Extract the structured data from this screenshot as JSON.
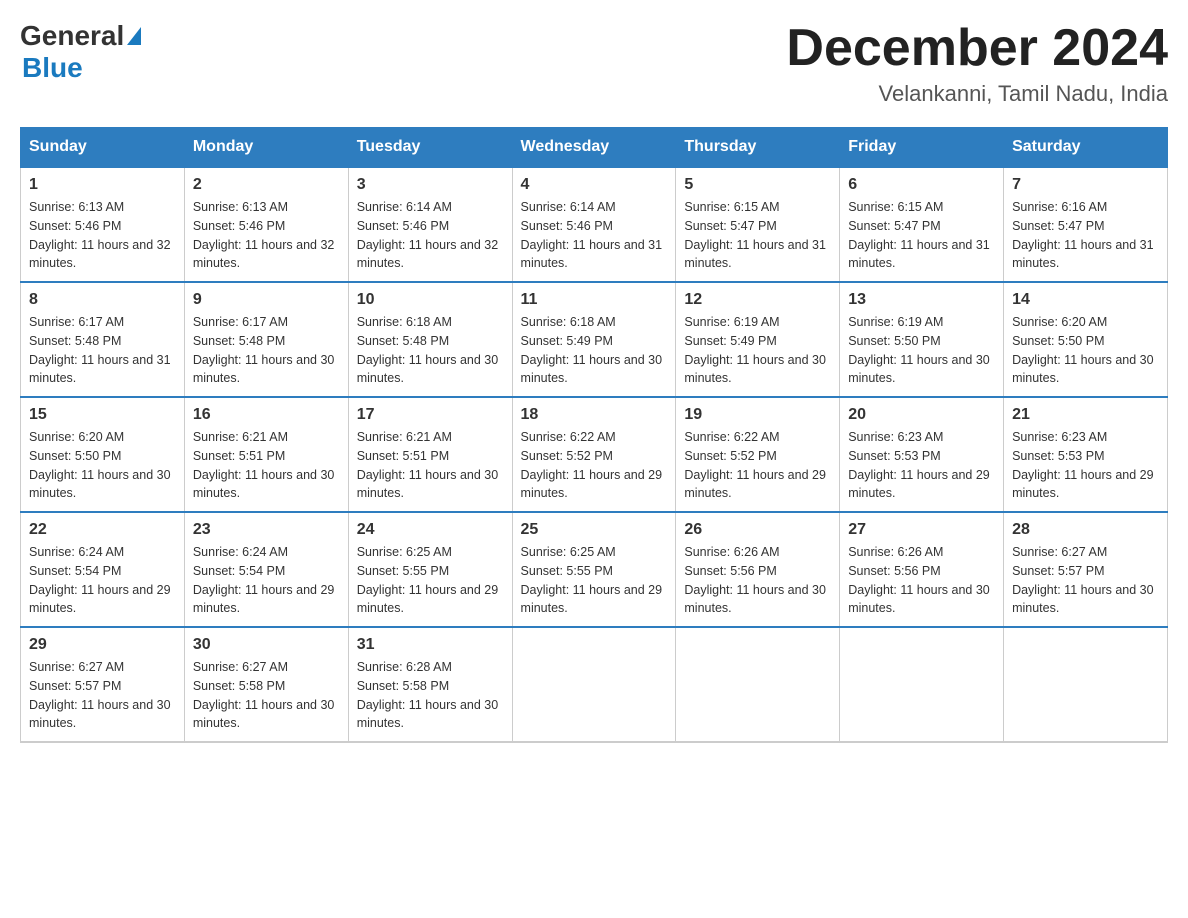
{
  "header": {
    "logo_general": "General",
    "logo_blue": "Blue",
    "month_title": "December 2024",
    "location": "Velankanni, Tamil Nadu, India"
  },
  "days_of_week": [
    "Sunday",
    "Monday",
    "Tuesday",
    "Wednesday",
    "Thursday",
    "Friday",
    "Saturday"
  ],
  "weeks": [
    [
      {
        "day": "1",
        "sunrise": "6:13 AM",
        "sunset": "5:46 PM",
        "daylight": "11 hours and 32 minutes."
      },
      {
        "day": "2",
        "sunrise": "6:13 AM",
        "sunset": "5:46 PM",
        "daylight": "11 hours and 32 minutes."
      },
      {
        "day": "3",
        "sunrise": "6:14 AM",
        "sunset": "5:46 PM",
        "daylight": "11 hours and 32 minutes."
      },
      {
        "day": "4",
        "sunrise": "6:14 AM",
        "sunset": "5:46 PM",
        "daylight": "11 hours and 31 minutes."
      },
      {
        "day": "5",
        "sunrise": "6:15 AM",
        "sunset": "5:47 PM",
        "daylight": "11 hours and 31 minutes."
      },
      {
        "day": "6",
        "sunrise": "6:15 AM",
        "sunset": "5:47 PM",
        "daylight": "11 hours and 31 minutes."
      },
      {
        "day": "7",
        "sunrise": "6:16 AM",
        "sunset": "5:47 PM",
        "daylight": "11 hours and 31 minutes."
      }
    ],
    [
      {
        "day": "8",
        "sunrise": "6:17 AM",
        "sunset": "5:48 PM",
        "daylight": "11 hours and 31 minutes."
      },
      {
        "day": "9",
        "sunrise": "6:17 AM",
        "sunset": "5:48 PM",
        "daylight": "11 hours and 30 minutes."
      },
      {
        "day": "10",
        "sunrise": "6:18 AM",
        "sunset": "5:48 PM",
        "daylight": "11 hours and 30 minutes."
      },
      {
        "day": "11",
        "sunrise": "6:18 AM",
        "sunset": "5:49 PM",
        "daylight": "11 hours and 30 minutes."
      },
      {
        "day": "12",
        "sunrise": "6:19 AM",
        "sunset": "5:49 PM",
        "daylight": "11 hours and 30 minutes."
      },
      {
        "day": "13",
        "sunrise": "6:19 AM",
        "sunset": "5:50 PM",
        "daylight": "11 hours and 30 minutes."
      },
      {
        "day": "14",
        "sunrise": "6:20 AM",
        "sunset": "5:50 PM",
        "daylight": "11 hours and 30 minutes."
      }
    ],
    [
      {
        "day": "15",
        "sunrise": "6:20 AM",
        "sunset": "5:50 PM",
        "daylight": "11 hours and 30 minutes."
      },
      {
        "day": "16",
        "sunrise": "6:21 AM",
        "sunset": "5:51 PM",
        "daylight": "11 hours and 30 minutes."
      },
      {
        "day": "17",
        "sunrise": "6:21 AM",
        "sunset": "5:51 PM",
        "daylight": "11 hours and 30 minutes."
      },
      {
        "day": "18",
        "sunrise": "6:22 AM",
        "sunset": "5:52 PM",
        "daylight": "11 hours and 29 minutes."
      },
      {
        "day": "19",
        "sunrise": "6:22 AM",
        "sunset": "5:52 PM",
        "daylight": "11 hours and 29 minutes."
      },
      {
        "day": "20",
        "sunrise": "6:23 AM",
        "sunset": "5:53 PM",
        "daylight": "11 hours and 29 minutes."
      },
      {
        "day": "21",
        "sunrise": "6:23 AM",
        "sunset": "5:53 PM",
        "daylight": "11 hours and 29 minutes."
      }
    ],
    [
      {
        "day": "22",
        "sunrise": "6:24 AM",
        "sunset": "5:54 PM",
        "daylight": "11 hours and 29 minutes."
      },
      {
        "day": "23",
        "sunrise": "6:24 AM",
        "sunset": "5:54 PM",
        "daylight": "11 hours and 29 minutes."
      },
      {
        "day": "24",
        "sunrise": "6:25 AM",
        "sunset": "5:55 PM",
        "daylight": "11 hours and 29 minutes."
      },
      {
        "day": "25",
        "sunrise": "6:25 AM",
        "sunset": "5:55 PM",
        "daylight": "11 hours and 29 minutes."
      },
      {
        "day": "26",
        "sunrise": "6:26 AM",
        "sunset": "5:56 PM",
        "daylight": "11 hours and 30 minutes."
      },
      {
        "day": "27",
        "sunrise": "6:26 AM",
        "sunset": "5:56 PM",
        "daylight": "11 hours and 30 minutes."
      },
      {
        "day": "28",
        "sunrise": "6:27 AM",
        "sunset": "5:57 PM",
        "daylight": "11 hours and 30 minutes."
      }
    ],
    [
      {
        "day": "29",
        "sunrise": "6:27 AM",
        "sunset": "5:57 PM",
        "daylight": "11 hours and 30 minutes."
      },
      {
        "day": "30",
        "sunrise": "6:27 AM",
        "sunset": "5:58 PM",
        "daylight": "11 hours and 30 minutes."
      },
      {
        "day": "31",
        "sunrise": "6:28 AM",
        "sunset": "5:58 PM",
        "daylight": "11 hours and 30 minutes."
      },
      null,
      null,
      null,
      null
    ]
  ]
}
